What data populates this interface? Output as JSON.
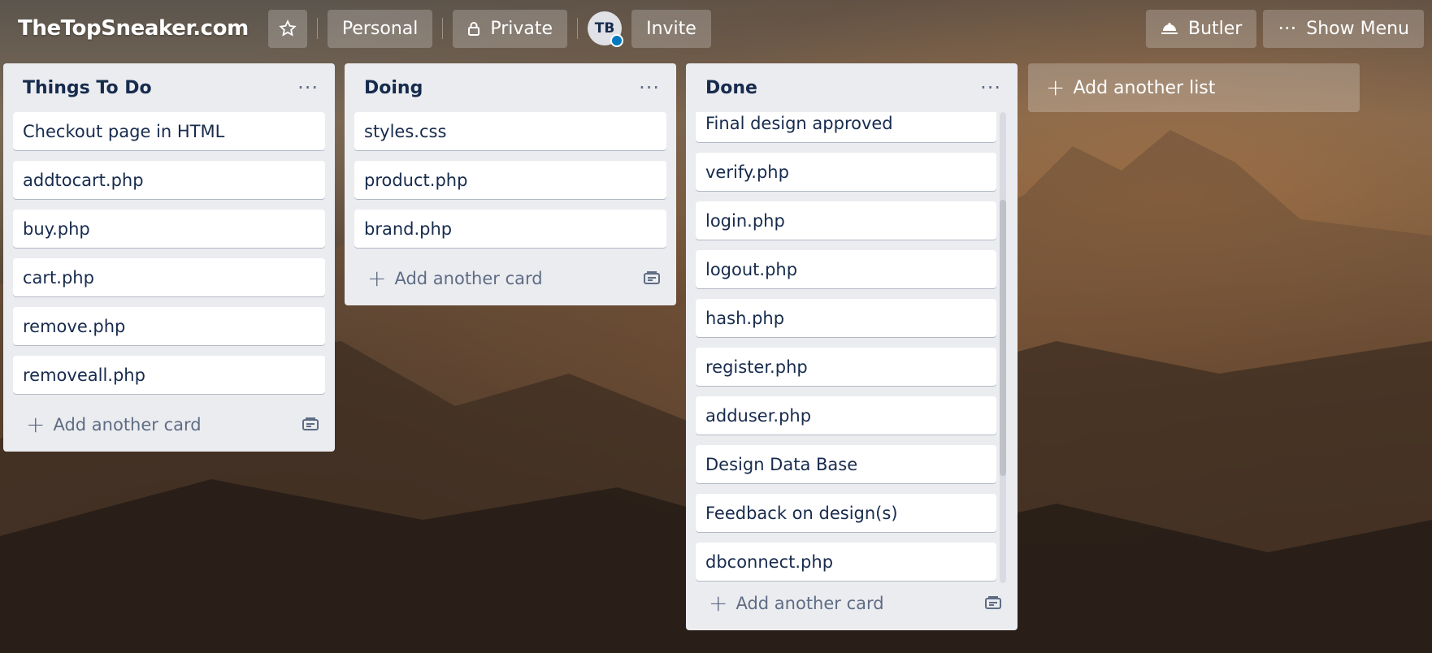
{
  "header": {
    "board_title": "TheTopSneaker.com",
    "star_icon": "star-icon",
    "personal_label": "Personal",
    "private_label": "Private",
    "avatar_initials": "TB",
    "invite_label": "Invite",
    "butler_label": "Butler",
    "show_menu_label": "Show Menu"
  },
  "lists": [
    {
      "title": "Things To Do",
      "cards": [
        "Checkout page in HTML",
        "addtocart.php",
        "buy.php",
        "cart.php",
        "remove.php",
        "removeall.php"
      ],
      "add_card_label": "Add another card"
    },
    {
      "title": "Doing",
      "cards": [
        "styles.css",
        "product.php",
        "brand.php"
      ],
      "add_card_label": "Add another card"
    },
    {
      "title": "Done",
      "cards": [
        "Final design approved",
        "verify.php",
        "login.php",
        "logout.php",
        "hash.php",
        "register.php",
        "adduser.php",
        "Design Data Base",
        "Feedback on design(s)",
        "dbconnect.php"
      ],
      "add_card_label": "Add another card"
    }
  ],
  "add_list_label": "Add another list",
  "colors": {
    "list_bg": "#ebecf0",
    "card_text": "#172b4d",
    "muted_text": "#5e6c84"
  }
}
